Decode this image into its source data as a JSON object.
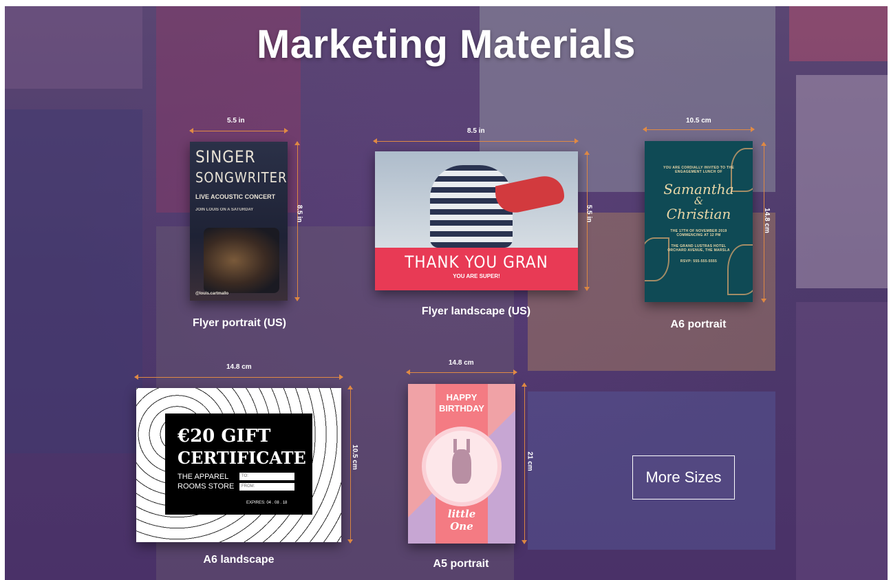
{
  "page": {
    "title": "Marketing Materials"
  },
  "items": [
    {
      "label": "Flyer portrait (US)",
      "width": "5.5 in",
      "height": "8.5 in",
      "preview": {
        "line1": "SINGER",
        "line2": "SONGWRITER",
        "line3": "LIVE ACOUSTIC CONCERT",
        "side_text": "JOIN LOUIS ON A SATURDAY",
        "footer": "@louis.cartmallo"
      }
    },
    {
      "label": "Flyer landscape (US)",
      "width": "8.5 in",
      "height": "5.5 in",
      "preview": {
        "headline": "THANK YOU GRAN",
        "sub": "YOU ARE SUPER!"
      }
    },
    {
      "label": "A6 portrait",
      "width": "10.5 cm",
      "height": "14.8 cm",
      "preview": {
        "intro": "YOU ARE CORDIALLY INVITED TO THE ENGAGEMENT LUNCH OF",
        "name1": "Samantha",
        "amp": "&",
        "name2": "Christian",
        "date": "THE 17TH OF NOVEMBER 2019 COMMENCING AT 12 PM",
        "venue": "THE GRAND LUSTRAS HOTEL ORCHARD AVENUE, THE MARSLA",
        "rsvp": "RSVP: 555-555-5555"
      }
    },
    {
      "label": "A6 landscape",
      "width": "14.8 cm",
      "height": "10.5 cm",
      "preview": {
        "amount": "€20 GIFT",
        "cert": "CERTIFICATE",
        "store": "THE APPAREL ROOMS STORE",
        "to": "TO:",
        "from": "FROM:",
        "expires": "EXPIRES: 04 . 08 . 18"
      }
    },
    {
      "label": "A5 portrait",
      "width": "14.8 cm",
      "height": "21 cm",
      "preview": {
        "line1": "HAPPY",
        "line2": "BIRTHDAY",
        "line3": "little",
        "line4": "One"
      }
    }
  ],
  "more_sizes_label": "More Sizes",
  "colors": {
    "dimension_line": "#e08a44",
    "background": "#4d3a6b",
    "text": "#ffffff"
  }
}
